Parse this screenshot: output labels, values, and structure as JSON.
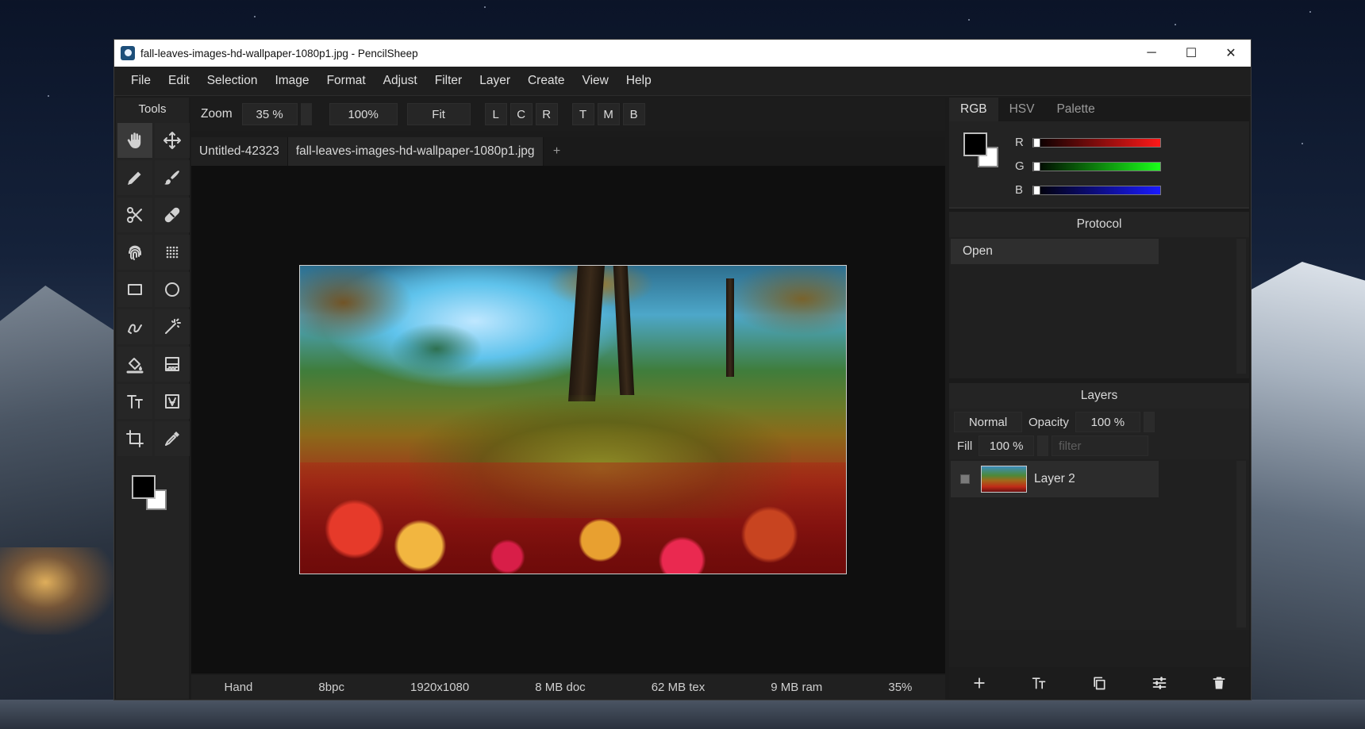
{
  "window": {
    "title": "fall-leaves-images-hd-wallpaper-1080p1.jpg - PencilSheep",
    "controls": {
      "minimize": "─",
      "maximize": "☐",
      "close": "✕"
    }
  },
  "menu": [
    "File",
    "Edit",
    "Selection",
    "Image",
    "Format",
    "Adjust",
    "Filter",
    "Layer",
    "Create",
    "View",
    "Help"
  ],
  "tools": {
    "header": "Tools",
    "items": [
      {
        "name": "hand-tool",
        "icon": "hand-icon",
        "active": true
      },
      {
        "name": "move-tool",
        "icon": "move-icon"
      },
      {
        "name": "pencil-tool",
        "icon": "pencil-icon"
      },
      {
        "name": "brush-tool",
        "icon": "brush-icon"
      },
      {
        "name": "scissors-tool",
        "icon": "scissors-icon"
      },
      {
        "name": "heal-tool",
        "icon": "bandage-icon"
      },
      {
        "name": "smudge-tool",
        "icon": "fingerprint-icon"
      },
      {
        "name": "pattern-tool",
        "icon": "dots-grid-icon"
      },
      {
        "name": "rectangle-tool",
        "icon": "rectangle-icon"
      },
      {
        "name": "ellipse-tool",
        "icon": "circle-icon"
      },
      {
        "name": "lasso-tool",
        "icon": "lasso-icon"
      },
      {
        "name": "magic-wand-tool",
        "icon": "magic-wand-icon"
      },
      {
        "name": "fill-tool",
        "icon": "paint-bucket-icon"
      },
      {
        "name": "gradient-tool",
        "icon": "gradient-icon"
      },
      {
        "name": "text-tool",
        "icon": "text-icon"
      },
      {
        "name": "text-frame-tool",
        "icon": "text-frame-icon"
      },
      {
        "name": "crop-tool",
        "icon": "crop-icon"
      },
      {
        "name": "eyedropper-tool",
        "icon": "eyedropper-icon"
      }
    ],
    "foreground_color": "#000000",
    "background_color": "#ffffff"
  },
  "toolbar": {
    "zoom_label": "Zoom",
    "zoom_value": "35 %",
    "btn_100": "100%",
    "btn_fit": "Fit",
    "align_h": [
      "L",
      "C",
      "R"
    ],
    "align_v": [
      "T",
      "M",
      "B"
    ]
  },
  "tabs": {
    "items": [
      "Untitled-42323",
      "fall-leaves-images-hd-wallpaper-1080p1.jpg"
    ],
    "active": 1,
    "add": "+"
  },
  "status": {
    "tool": "Hand",
    "depth": "8bpc",
    "size": "1920x1080",
    "doc": "8 MB doc",
    "tex": "62 MB tex",
    "ram": "9 MB ram",
    "zoom": "35%"
  },
  "color_panel": {
    "tabs": [
      "RGB",
      "HSV",
      "Palette"
    ],
    "active_tab": "RGB",
    "sliders": [
      {
        "label": "R",
        "value": 0,
        "color": "#ff0000"
      },
      {
        "label": "G",
        "value": 0,
        "color": "#00ff00"
      },
      {
        "label": "B",
        "value": 0,
        "color": "#0000ff"
      }
    ]
  },
  "protocol": {
    "header": "Protocol",
    "items": [
      "Open"
    ]
  },
  "layers": {
    "header": "Layers",
    "blend_mode": "Normal",
    "opacity_label": "Opacity",
    "opacity_value": "100 %",
    "fill_label": "Fill",
    "fill_value": "100 %",
    "filter_placeholder": "filter",
    "items": [
      {
        "name": "Layer 2"
      }
    ],
    "actions": [
      "add-layer-icon",
      "text-layer-icon",
      "duplicate-icon",
      "adjustments-icon",
      "trash-icon"
    ]
  }
}
